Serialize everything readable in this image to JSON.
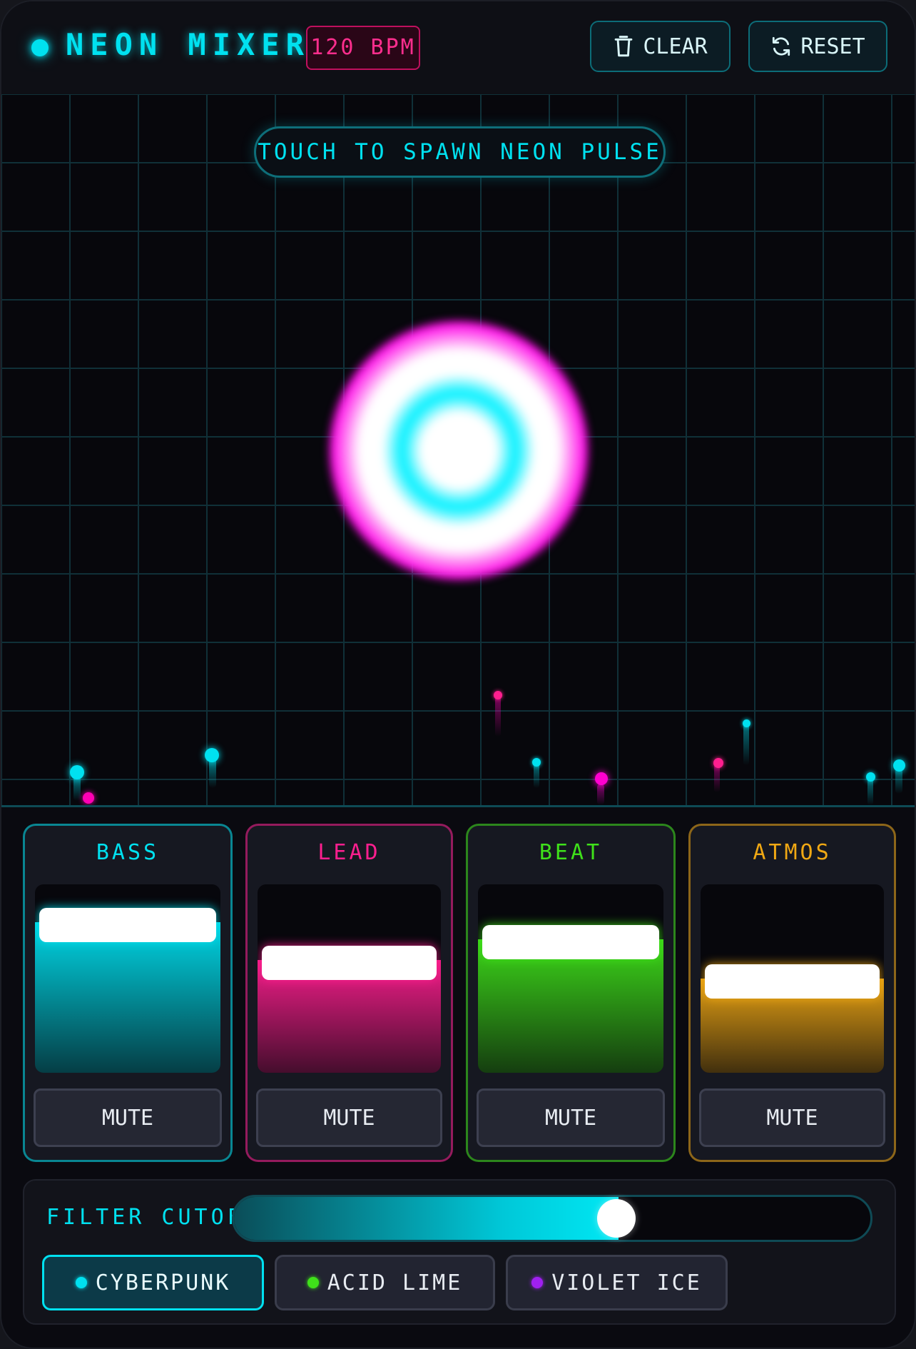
{
  "header": {
    "title": "NEON MIXER",
    "bpm": "120 BPM",
    "clear_label": "CLEAR",
    "reset_label": "RESET"
  },
  "stage": {
    "hint": "TOUCH TO SPAWN NEON PULSE"
  },
  "channels": [
    {
      "name": "BASS",
      "color": "#00e1f0",
      "level": 0.8,
      "mute_label": "MUTE"
    },
    {
      "name": "LEAD",
      "color": "#ff1f8f",
      "level": 0.6,
      "mute_label": "MUTE"
    },
    {
      "name": "BEAT",
      "color": "#3fe11a",
      "level": 0.71,
      "mute_label": "MUTE"
    },
    {
      "name": "ATMOS",
      "color": "#f0a814",
      "level": 0.5,
      "mute_label": "MUTE"
    }
  ],
  "filter": {
    "label": "FILTER CUTOFF",
    "value": 0.6
  },
  "themes": [
    {
      "label": "CYBERPUNK",
      "dot_color": "#00e1f0",
      "active": true
    },
    {
      "label": "ACID LIME",
      "dot_color": "#3fe11a",
      "active": false
    },
    {
      "label": "VIOLET ICE",
      "dot_color": "#a020f0",
      "active": false
    }
  ]
}
